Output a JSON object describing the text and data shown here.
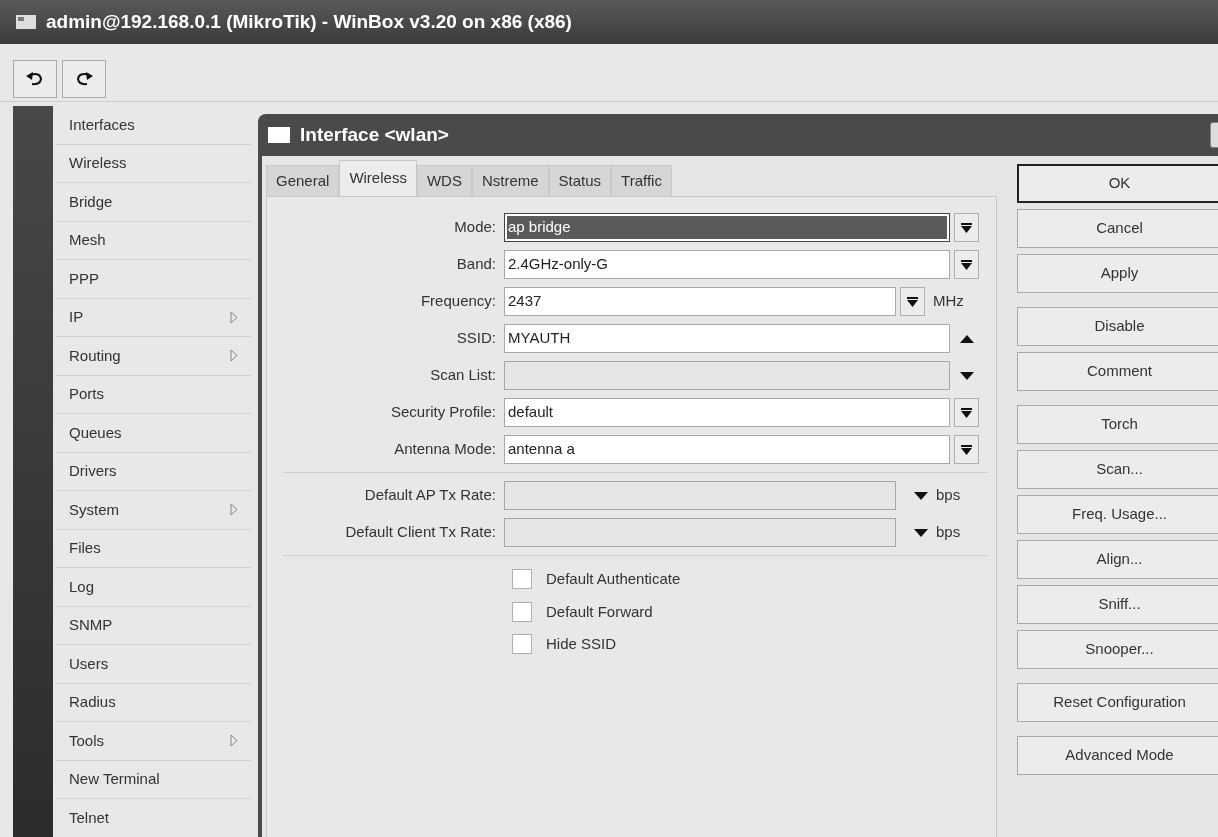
{
  "window": {
    "title": "admin@192.168.0.1 (MikroTik) - WinBox v3.20 on x86 (x86)"
  },
  "toolbar": [
    {
      "kind": "undo"
    },
    {
      "kind": "redo"
    }
  ],
  "menu": [
    {
      "label": "Interfaces",
      "submenu": false
    },
    {
      "label": "Wireless",
      "submenu": false
    },
    {
      "label": "Bridge",
      "submenu": false
    },
    {
      "label": "Mesh",
      "submenu": false
    },
    {
      "label": "PPP",
      "submenu": false
    },
    {
      "label": "IP",
      "submenu": true
    },
    {
      "label": "Routing",
      "submenu": true
    },
    {
      "label": "Ports",
      "submenu": false
    },
    {
      "label": "Queues",
      "submenu": false
    },
    {
      "label": "Drivers",
      "submenu": false
    },
    {
      "label": "System",
      "submenu": true
    },
    {
      "label": "Files",
      "submenu": false
    },
    {
      "label": "Log",
      "submenu": false
    },
    {
      "label": "SNMP",
      "submenu": false
    },
    {
      "label": "Users",
      "submenu": false
    },
    {
      "label": "Radius",
      "submenu": false
    },
    {
      "label": "Tools",
      "submenu": true
    },
    {
      "label": "New Terminal",
      "submenu": false
    },
    {
      "label": "Telnet",
      "submenu": false
    }
  ],
  "dialog": {
    "title": "Interface <wlan>",
    "tabs": [
      {
        "label": "General",
        "selected": false
      },
      {
        "label": "Wireless",
        "selected": true
      },
      {
        "label": "WDS",
        "selected": false
      },
      {
        "label": "Nstreme",
        "selected": false
      },
      {
        "label": "Status",
        "selected": false
      },
      {
        "label": "Traffic",
        "selected": false
      }
    ],
    "field_groups": [
      [
        {
          "label": "Mode:",
          "value": "ap bridge",
          "kind": "dropdown",
          "selected": true,
          "disabled": false
        },
        {
          "label": "Band:",
          "value": "2.4GHz-only-G",
          "kind": "dropdown",
          "selected": false,
          "disabled": false
        },
        {
          "label": "Frequency:",
          "value": "2437",
          "kind": "dropdown",
          "unit": "MHz",
          "selected": false,
          "disabled": false
        },
        {
          "label": "SSID:",
          "value": "MYAUTH",
          "kind": "collapse",
          "selected": false,
          "disabled": false
        },
        {
          "label": "Scan List:",
          "kind": "expand",
          "selected": false,
          "disabled": true
        },
        {
          "label": "Security Profile:",
          "value": "default",
          "kind": "dropdown",
          "selected": false,
          "disabled": false
        },
        {
          "label": "Antenna Mode:",
          "value": "antenna a",
          "kind": "dropdown",
          "selected": false,
          "disabled": false
        }
      ],
      [
        {
          "label": "Default AP Tx Rate:",
          "kind": "expand",
          "unit": "bps",
          "selected": false,
          "disabled": true
        },
        {
          "label": "Default Client Tx Rate:",
          "kind": "expand",
          "unit": "bps",
          "selected": false,
          "disabled": true
        }
      ]
    ],
    "checkboxes": [
      {
        "label": "Default Authenticate",
        "checked": false
      },
      {
        "label": "Default Forward",
        "checked": false
      },
      {
        "label": "Hide SSID",
        "checked": false
      }
    ],
    "button_groups": [
      [
        {
          "label": "OK",
          "default": true
        },
        {
          "label": "Cancel",
          "default": false
        },
        {
          "label": "Apply",
          "default": false
        }
      ],
      [
        {
          "label": "Disable",
          "default": false
        },
        {
          "label": "Comment",
          "default": false
        }
      ],
      [
        {
          "label": "Torch",
          "default": false
        },
        {
          "label": "Scan...",
          "default": false
        },
        {
          "label": "Freq. Usage...",
          "default": false
        },
        {
          "label": "Align...",
          "default": false
        },
        {
          "label": "Sniff...",
          "default": false
        },
        {
          "label": "Snooper...",
          "default": false
        }
      ],
      [
        {
          "label": "Reset Configuration",
          "default": false
        }
      ],
      [
        {
          "label": "Advanced Mode",
          "default": false
        }
      ]
    ]
  }
}
